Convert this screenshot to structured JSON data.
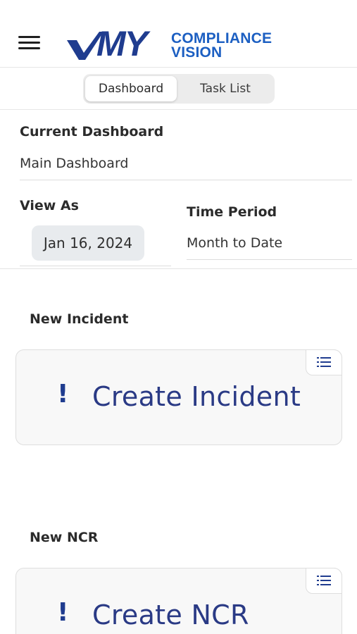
{
  "brand": {
    "logo_big": "MY",
    "logo_line1": "COMPLIANCE",
    "logo_line2": "VISION",
    "primary_color": "#1f3c8f",
    "accent_color": "#1c5fc2"
  },
  "tabs": [
    {
      "label": "Dashboard",
      "active": true
    },
    {
      "label": "Task List",
      "active": false
    }
  ],
  "dashboard": {
    "current_label": "Current Dashboard",
    "current_value": "Main Dashboard",
    "view_as_label": "View As",
    "view_as_value": "Jan 16, 2024",
    "time_period_label": "Time Period",
    "time_period_value": "Month to Date"
  },
  "sections": [
    {
      "title": "New Incident",
      "card_label": "Create Incident",
      "icon": "exclamation-icon",
      "menu_icon": "list-icon"
    },
    {
      "title": "New NCR",
      "card_label": "Create NCR",
      "icon": "exclamation-icon",
      "menu_icon": "list-icon"
    }
  ],
  "icons": {
    "menu": "hamburger-menu-icon",
    "card_icon_glyph": "!"
  }
}
